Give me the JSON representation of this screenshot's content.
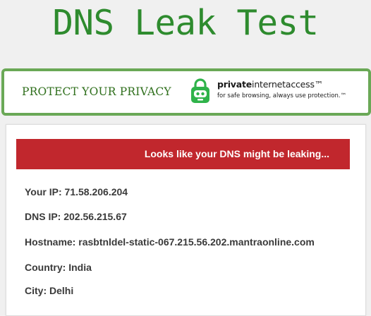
{
  "page": {
    "title": "DNS Leak Test"
  },
  "ad": {
    "headline": "PROTECT YOUR PRIVACY",
    "brand_bold": "private",
    "brand_regular": "internetaccess™",
    "tagline": "for safe browsing, always use protection.™",
    "logo_icon": "padlock-robot-icon",
    "accent_color": "#6aa856",
    "logo_color": "#2fb34a"
  },
  "result": {
    "status_message": "Looks like your DNS might be leaking...",
    "status_color": "#c1272d",
    "rows": [
      {
        "label": "Your IP:",
        "value": "71.58.206.204"
      },
      {
        "label": "DNS IP:",
        "value": "202.56.215.67"
      },
      {
        "label": "Hostname:",
        "value": "rasbtnldel-static-067.215.56.202.mantraonline.com"
      },
      {
        "label": "Country:",
        "value": "India"
      },
      {
        "label": "City:",
        "value": "Delhi"
      }
    ]
  }
}
